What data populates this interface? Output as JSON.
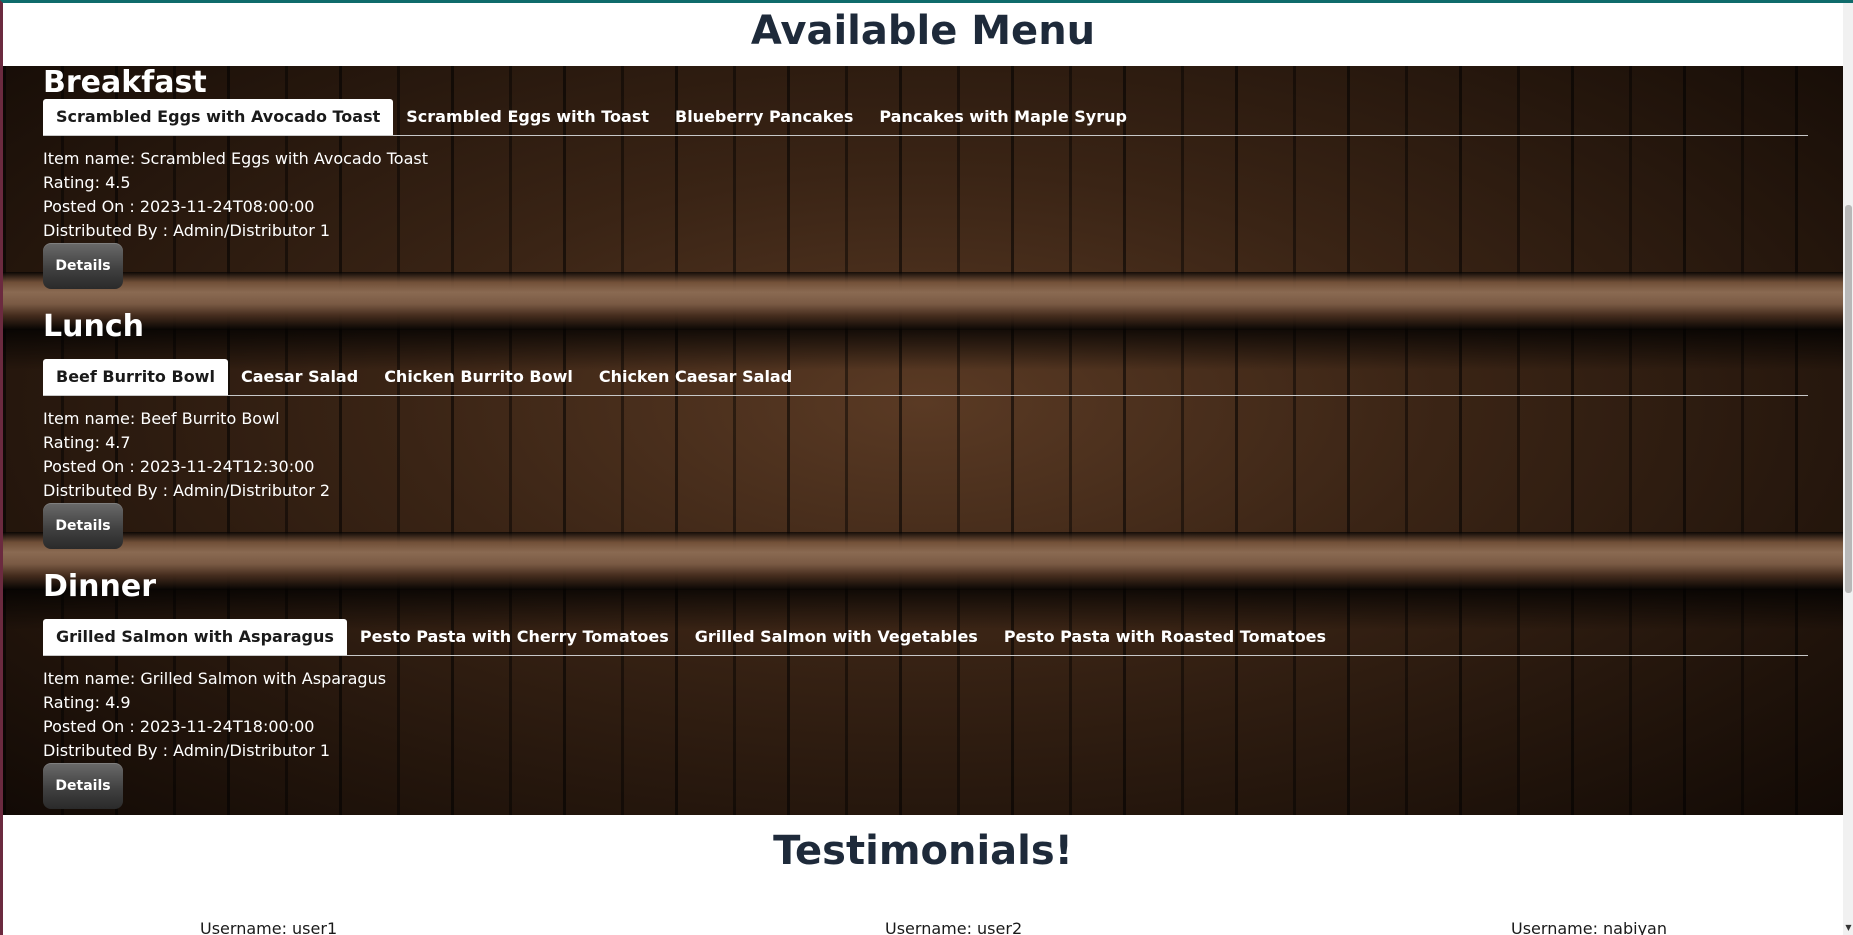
{
  "page": {
    "title": "Available Menu"
  },
  "sections": [
    {
      "title": "Breakfast",
      "tabs": [
        "Scrambled Eggs with Avocado Toast",
        "Scrambled Eggs with Toast",
        "Blueberry Pancakes",
        "Pancakes with Maple Syrup"
      ],
      "active_tab": 0,
      "item_name": "Item name: Scrambled Eggs with Avocado Toast",
      "rating": "Rating: 4.5",
      "posted_on": "Posted On : 2023-11-24T08:00:00",
      "distributed_by": "Distributed By : Admin/Distributor 1",
      "details_label": "Details"
    },
    {
      "title": "Lunch",
      "tabs": [
        "Beef Burrito Bowl",
        "Caesar Salad",
        "Chicken Burrito Bowl",
        "Chicken Caesar Salad"
      ],
      "active_tab": 0,
      "item_name": "Item name: Beef Burrito Bowl",
      "rating": "Rating: 4.7",
      "posted_on": "Posted On : 2023-11-24T12:30:00",
      "distributed_by": "Distributed By : Admin/Distributor 2",
      "details_label": "Details"
    },
    {
      "title": "Dinner",
      "tabs": [
        "Grilled Salmon with Asparagus",
        "Pesto Pasta with Cherry Tomatoes",
        "Grilled Salmon with Vegetables",
        "Pesto Pasta with Roasted Tomatoes"
      ],
      "active_tab": 0,
      "item_name": "Item name: Grilled Salmon with Asparagus",
      "rating": "Rating: 4.9",
      "posted_on": "Posted On : 2023-11-24T18:00:00",
      "distributed_by": "Distributed By : Admin/Distributor 1",
      "details_label": "Details"
    }
  ],
  "testimonials": {
    "title": "Testimonials!",
    "users": [
      "Username: user1",
      "Username: user2",
      "Username: nabiyan"
    ]
  },
  "colors": {
    "title_text": "#1e2a3a",
    "top_border": "#0f6b6b",
    "left_border": "#6b2a3f",
    "active_tab_bg": "#ffffff",
    "section_text": "#ffffff"
  }
}
